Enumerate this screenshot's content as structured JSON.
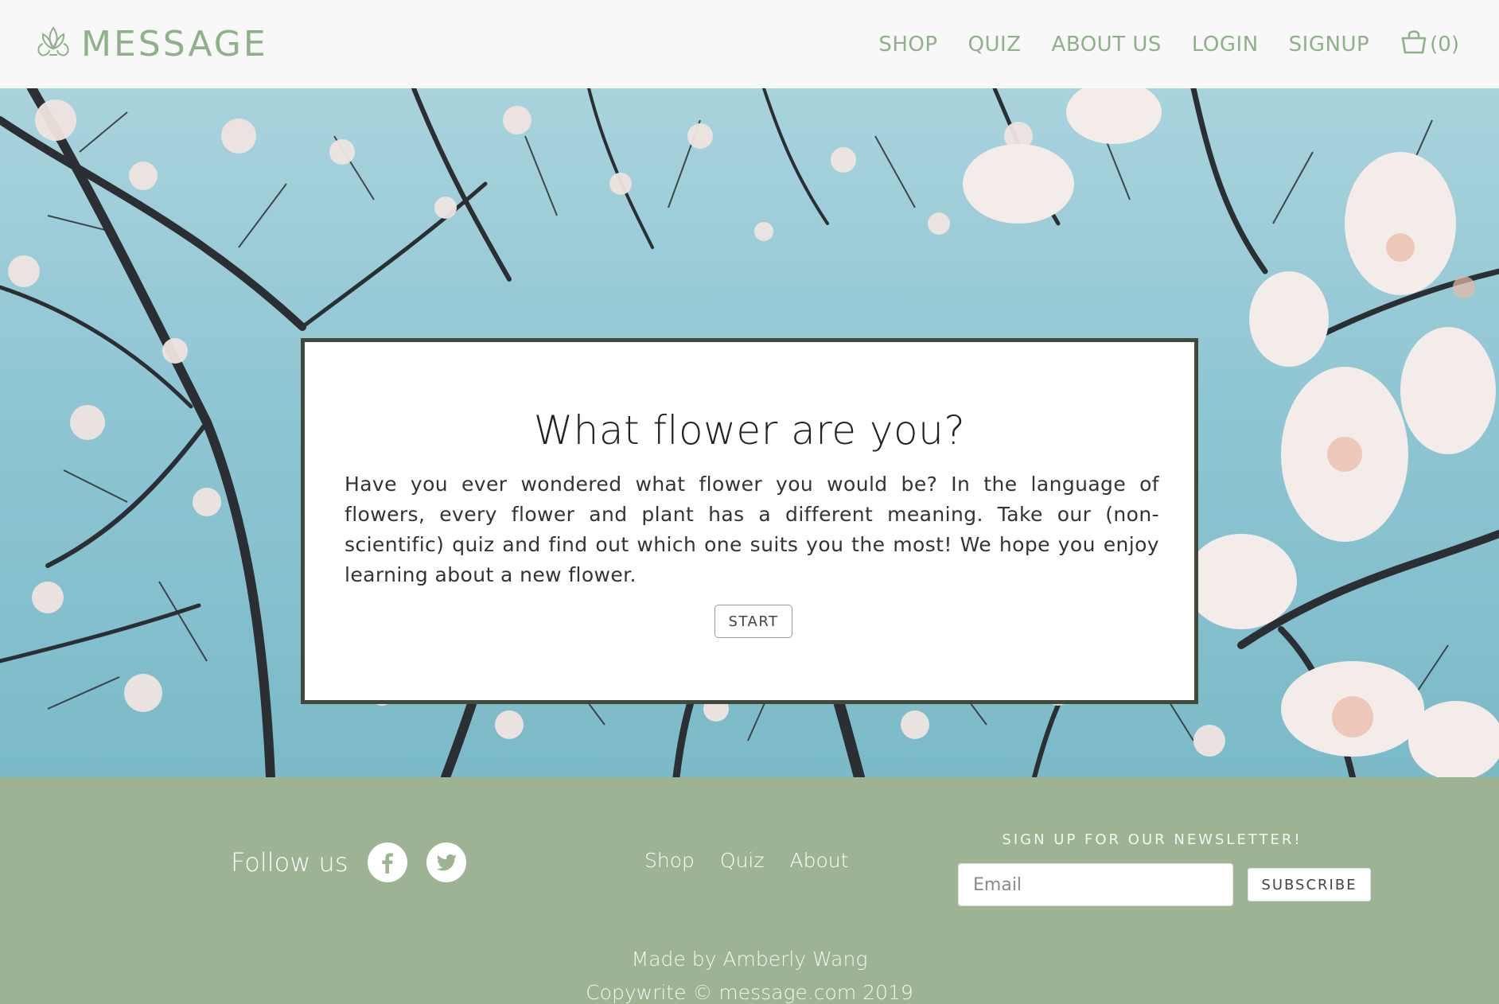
{
  "header": {
    "logo_text": "MESSAGE",
    "nav": [
      "SHOP",
      "QUIZ",
      "ABOUT US",
      "LOGIN",
      "SIGNUP"
    ],
    "cart_count": "(0)"
  },
  "quiz": {
    "title": "What flower are you?",
    "body": "Have you ever wondered what flower you would be? In the language of flowers, every flower and plant has a different meaning. Take our (non-scientific) quiz and find out which one suits you the most! We hope you enjoy learning about a new flower.",
    "start_label": "START"
  },
  "footer": {
    "follow_label": "Follow us",
    "links": [
      "Shop",
      "Quiz",
      "About"
    ],
    "newsletter_label": "SIGN UP FOR OUR NEWSLETTER!",
    "email_placeholder": "Email",
    "subscribe_label": "SUBSCRIBE",
    "made_by": "Made by Amberly Wang",
    "copyright": "Copywrite © message.com 2019"
  },
  "colors": {
    "brand_green": "#8fb08a",
    "footer_bg": "#9db393",
    "card_border": "#3f4a3a"
  },
  "icons": [
    "lotus-logo-icon",
    "shopping-bag-icon",
    "facebook-icon",
    "twitter-icon"
  ]
}
